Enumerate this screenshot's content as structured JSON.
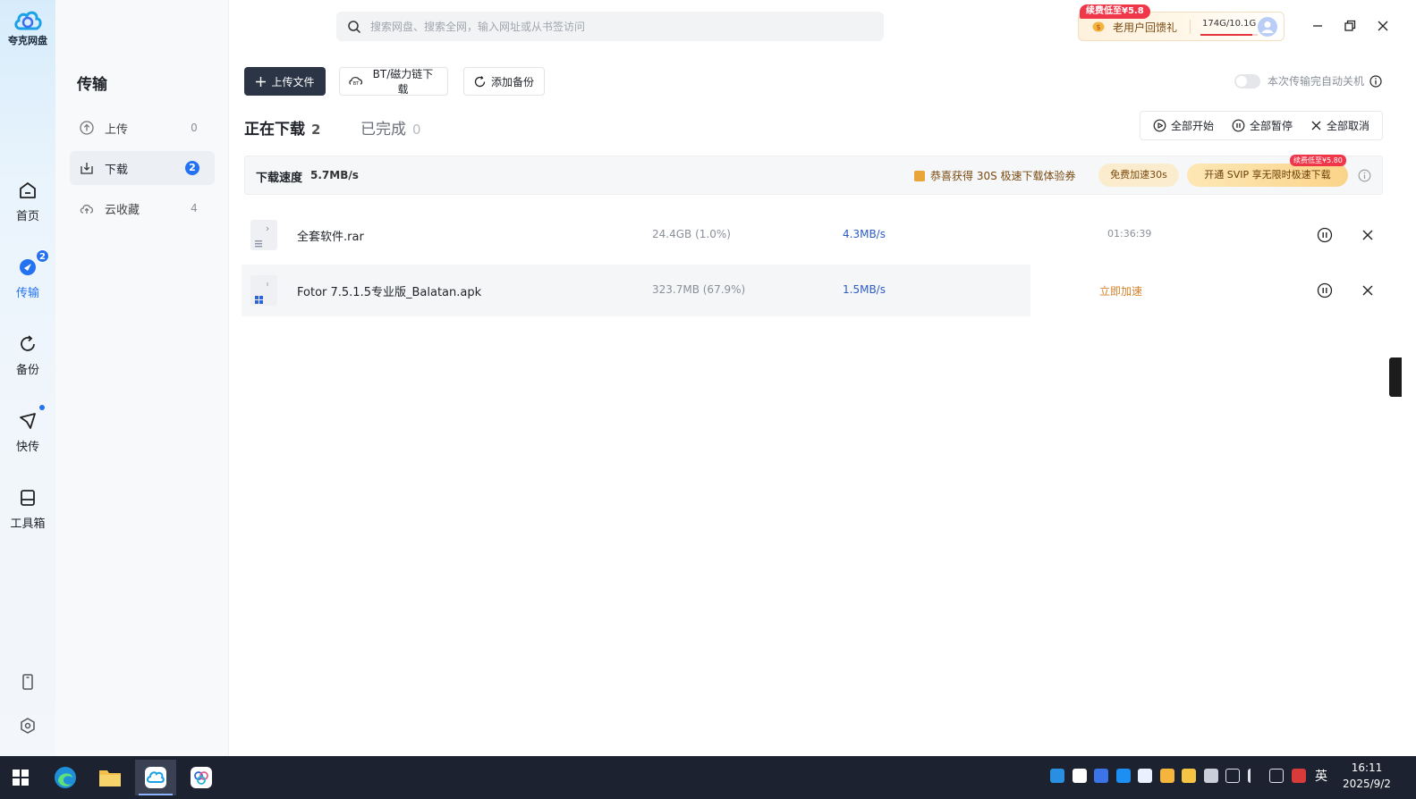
{
  "app": {
    "name": "夸克网盘"
  },
  "rail": {
    "items": [
      {
        "label": "首页"
      },
      {
        "label": "传输",
        "badge": "2"
      },
      {
        "label": "备份"
      },
      {
        "label": "快传"
      },
      {
        "label": "工具箱"
      }
    ]
  },
  "search": {
    "placeholder": "搜索网盘、搜索全网，输入网址或从书签访问"
  },
  "promo": {
    "tag": "续费低至¥5.8",
    "text": "老用户回馈礼",
    "quota": "174G/10.1G",
    "quota_fraction": 0.9
  },
  "sidebar": {
    "title": "传输",
    "items": [
      {
        "label": "上传",
        "count": "0"
      },
      {
        "label": "下载",
        "count": "2"
      },
      {
        "label": "云收藏",
        "count": "4"
      }
    ]
  },
  "toolbar": {
    "upload_label": "上传文件",
    "bt_label": "BT/磁力链下载",
    "backup_label": "添加备份",
    "autoshut_label": "本次传输完自动关机"
  },
  "tabs": [
    {
      "label": "正在下载",
      "count": "2"
    },
    {
      "label": "已完成",
      "count": "0"
    }
  ],
  "actions": {
    "start_all": "全部开始",
    "pause_all": "全部暂停",
    "cancel_all": "全部取消"
  },
  "banner": {
    "label": "下载速度",
    "value": "5.7MB/s",
    "coupon": "恭喜获得 30S 极速下载体验券",
    "free_btn": "免费加速30s",
    "svip_btn": "开通 SVIP 享无限时极速下载",
    "svip_tag": "续费低至¥5.80"
  },
  "downloads": [
    {
      "name": "全套软件.rar",
      "size": "24.4GB (1.0%)",
      "speed": "4.3MB/s",
      "remaining": "01:36:39"
    },
    {
      "name": "Fotor 7.5.1.5专业版_Balatan.apk",
      "size": "323.7MB (67.9%)",
      "speed": "1.5MB/s",
      "accelerate": "立即加速"
    }
  ],
  "taskbar": {
    "ime": "英",
    "time": "16:11",
    "date": "2025/9/2"
  },
  "colors": {
    "accent": "#2472f2",
    "primary_button": "#2b3546",
    "accelerate": "#d9822b",
    "speed_text": "#2b5cc4",
    "promo_red": "#f0374a"
  }
}
